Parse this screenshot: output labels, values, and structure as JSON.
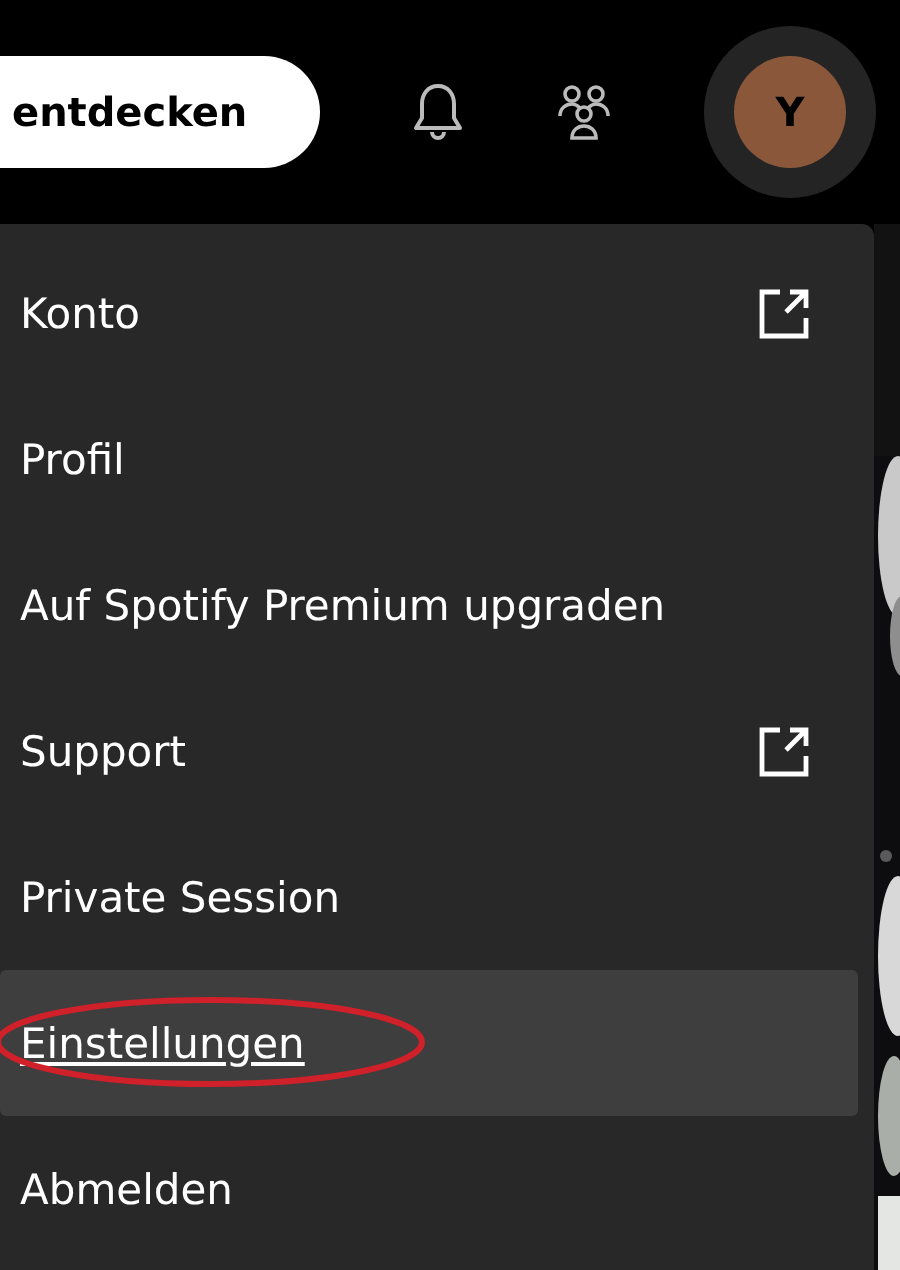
{
  "header": {
    "search_button": "entdecken",
    "avatar": "Y"
  },
  "menu": {
    "items": [
      {
        "label": "Konto",
        "external": true,
        "highlighted": false
      },
      {
        "label": "Profil",
        "external": false,
        "highlighted": false
      },
      {
        "label": "Auf Spotify Premium upgraden",
        "external": false,
        "highlighted": false
      },
      {
        "label": "Support",
        "external": true,
        "highlighted": false
      },
      {
        "label": "Private Session",
        "external": false,
        "highlighted": false
      },
      {
        "label": "Einstellungen",
        "external": false,
        "highlighted": true
      },
      {
        "label": "Abmelden",
        "external": false,
        "highlighted": false
      }
    ]
  }
}
